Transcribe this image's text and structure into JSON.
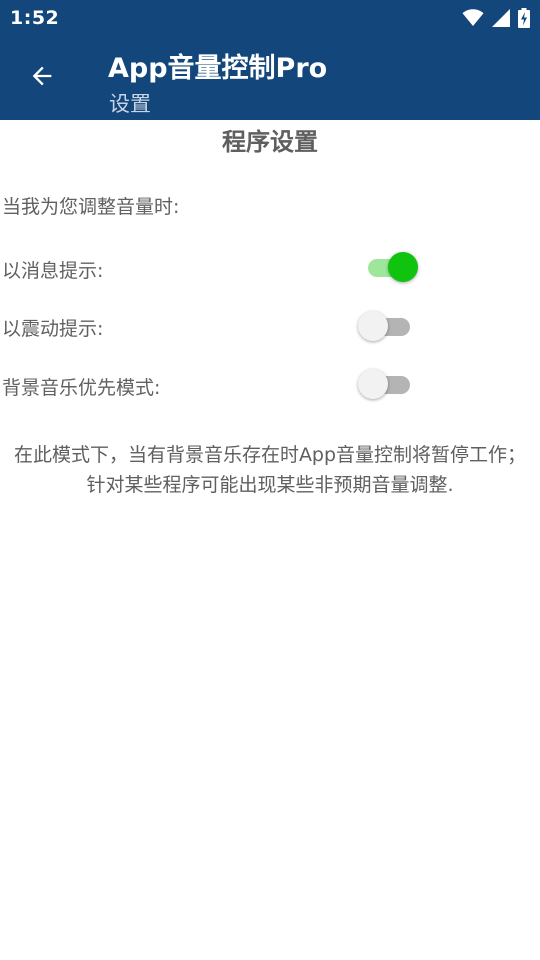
{
  "status_bar": {
    "time": "1:52",
    "icons": [
      "wifi-icon",
      "signal-icon",
      "battery-charging-icon"
    ]
  },
  "app_bar": {
    "title": "App音量控制Pro",
    "subtitle": "设置",
    "back_icon": "arrow-back-icon"
  },
  "content": {
    "section_title": "程序设置",
    "adjust_label": "当我为您调整音量时:",
    "settings": [
      {
        "label": "以消息提示:",
        "enabled": true
      },
      {
        "label": "以震动提示:",
        "enabled": false
      },
      {
        "label": "背景音乐优先模式:",
        "enabled": false
      }
    ],
    "description": "在此模式下，当有背景音乐存在时App音量控制将暂停工作；针对某些程序可能出现某些非预期音量调整."
  },
  "colors": {
    "app_bar": "#13467a",
    "switch_on_thumb": "#0fc30f",
    "switch_on_track": "#9ee79a",
    "switch_off_thumb": "#f2f2f2",
    "switch_off_track": "#b4b4b4",
    "text": "#616161"
  }
}
